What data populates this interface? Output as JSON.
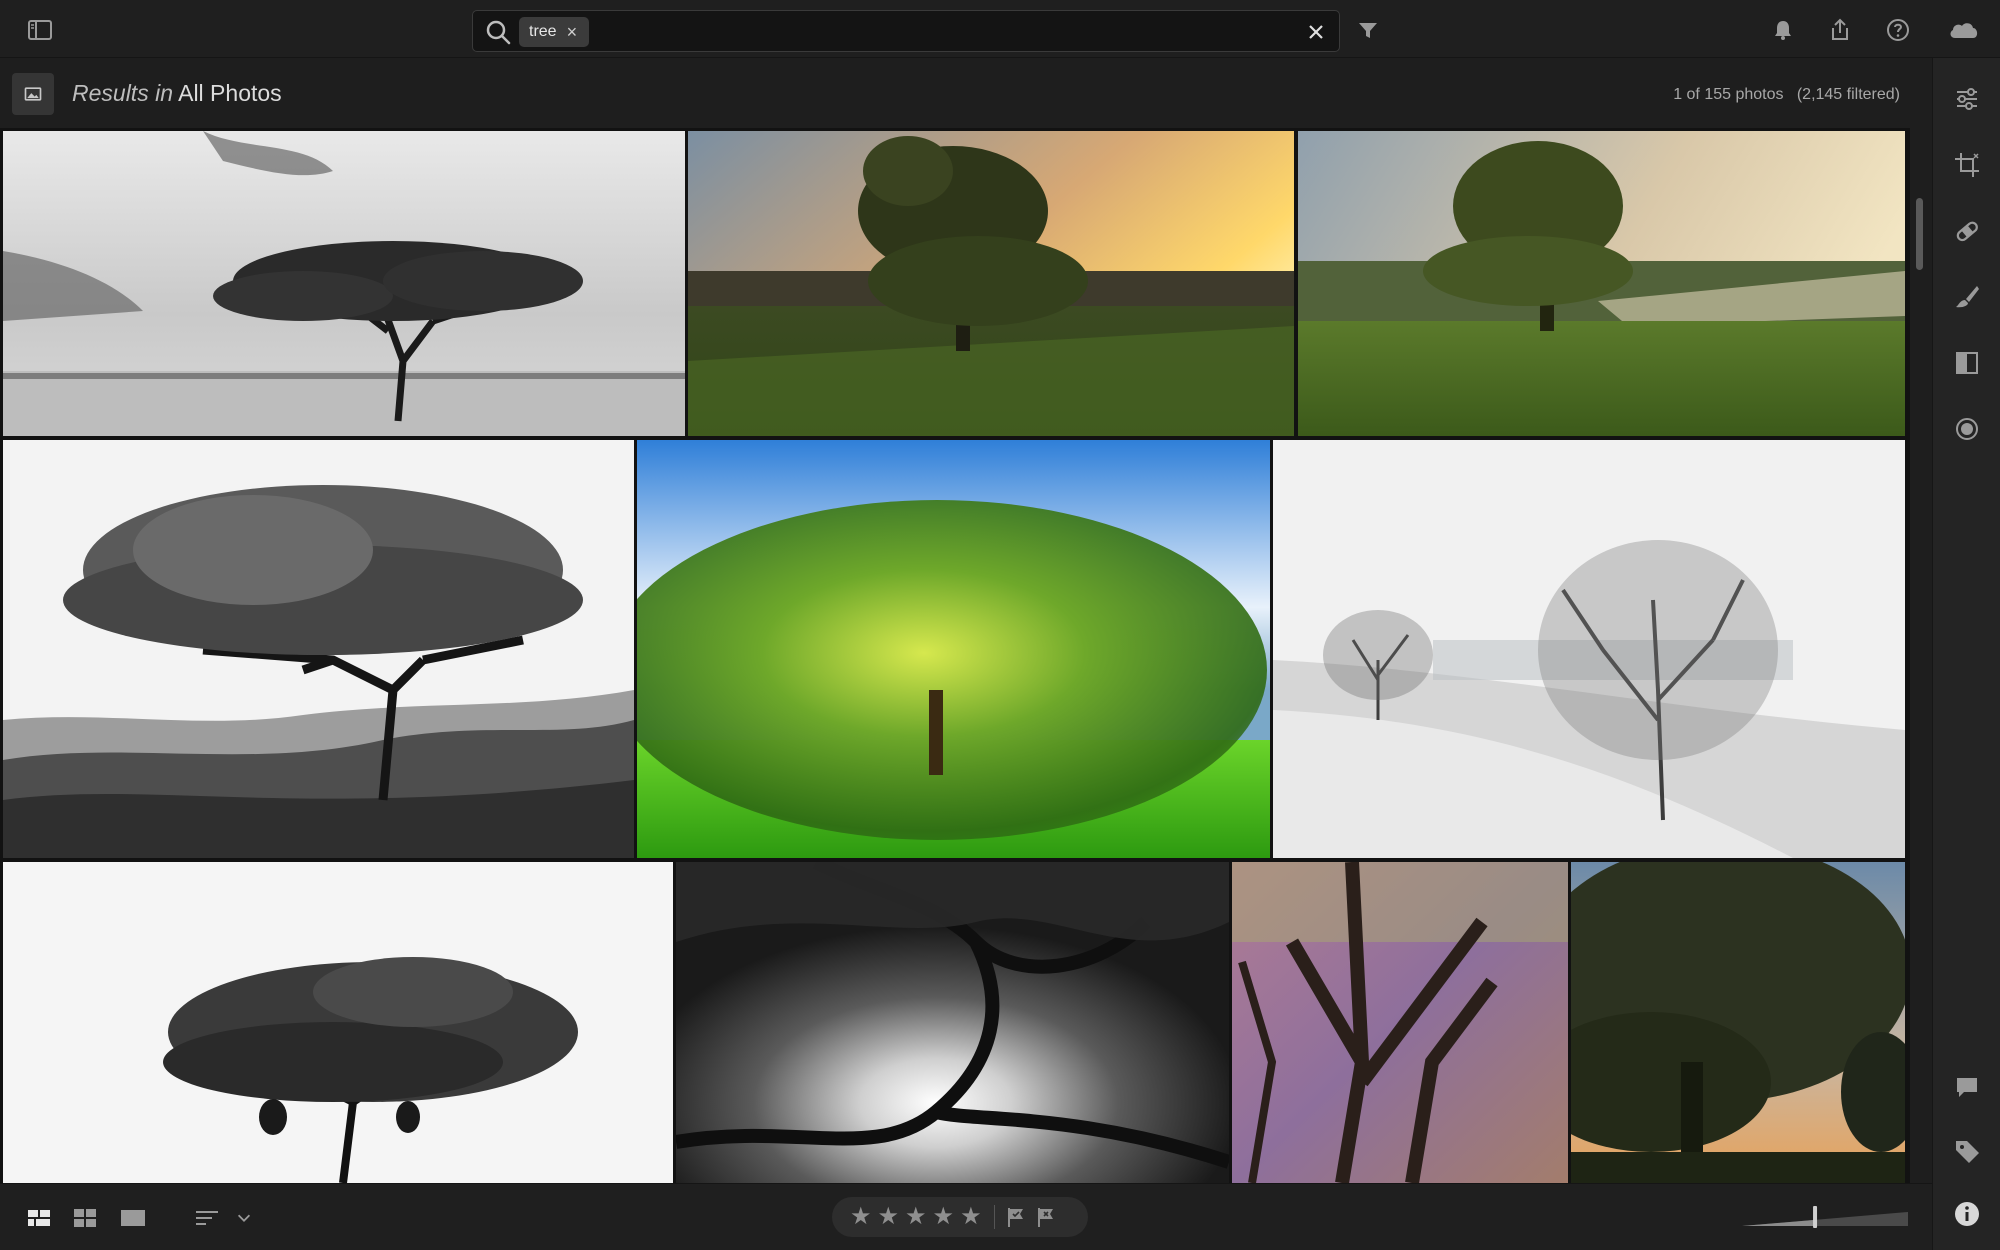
{
  "topbar": {
    "sidebar_toggle_icon": "sidebar-toggle-icon",
    "search": {
      "chip_label": "tree",
      "chip_remove": "×",
      "input_value": "",
      "placeholder": ""
    },
    "icons": [
      "filter-icon",
      "bell-icon",
      "share-icon",
      "help-icon",
      "cloud-icon"
    ]
  },
  "subheader": {
    "results_prefix": "Results in",
    "results_scope": "All Photos",
    "count": "1 of 155 photos   (2,145 filtered)"
  },
  "photos": [
    {
      "name": "photo-bw-acacia-tree-savanna"
    },
    {
      "name": "photo-oak-tree-sunset-field"
    },
    {
      "name": "photo-oak-tree-sunset-field-2"
    },
    {
      "name": "photo-bw-acacia-tree-bush"
    },
    {
      "name": "photo-zoom-blur-green-tree"
    },
    {
      "name": "photo-bare-trees-snow-hill"
    },
    {
      "name": "photo-bw-lone-acacia-tree"
    },
    {
      "name": "photo-bw-tree-canopy-from-below"
    },
    {
      "name": "photo-purple-leaf-tree"
    },
    {
      "name": "photo-tree-silhouette-dusk"
    }
  ],
  "rightpanel": {
    "icons": [
      "edit-sliders-icon",
      "crop-icon",
      "healing-icon",
      "brush-icon",
      "linear-gradient-icon",
      "radial-gradient-icon",
      "comment-icon",
      "tag-icon",
      "info-icon"
    ]
  },
  "bottombar": {
    "view_icons": [
      "square-grid-view-icon",
      "photo-grid-view-icon",
      "detail-view-icon",
      "sort-icon",
      "chevron-down-icon"
    ],
    "stars": [
      "★",
      "★",
      "★",
      "★",
      "★"
    ],
    "flags": [
      "pick-flag-icon",
      "reject-flag-icon"
    ],
    "thumbnail_size": 0.44
  },
  "colors": {
    "background": "#1e1e1e",
    "panel": "#242424",
    "chip": "#3b3b3b"
  }
}
